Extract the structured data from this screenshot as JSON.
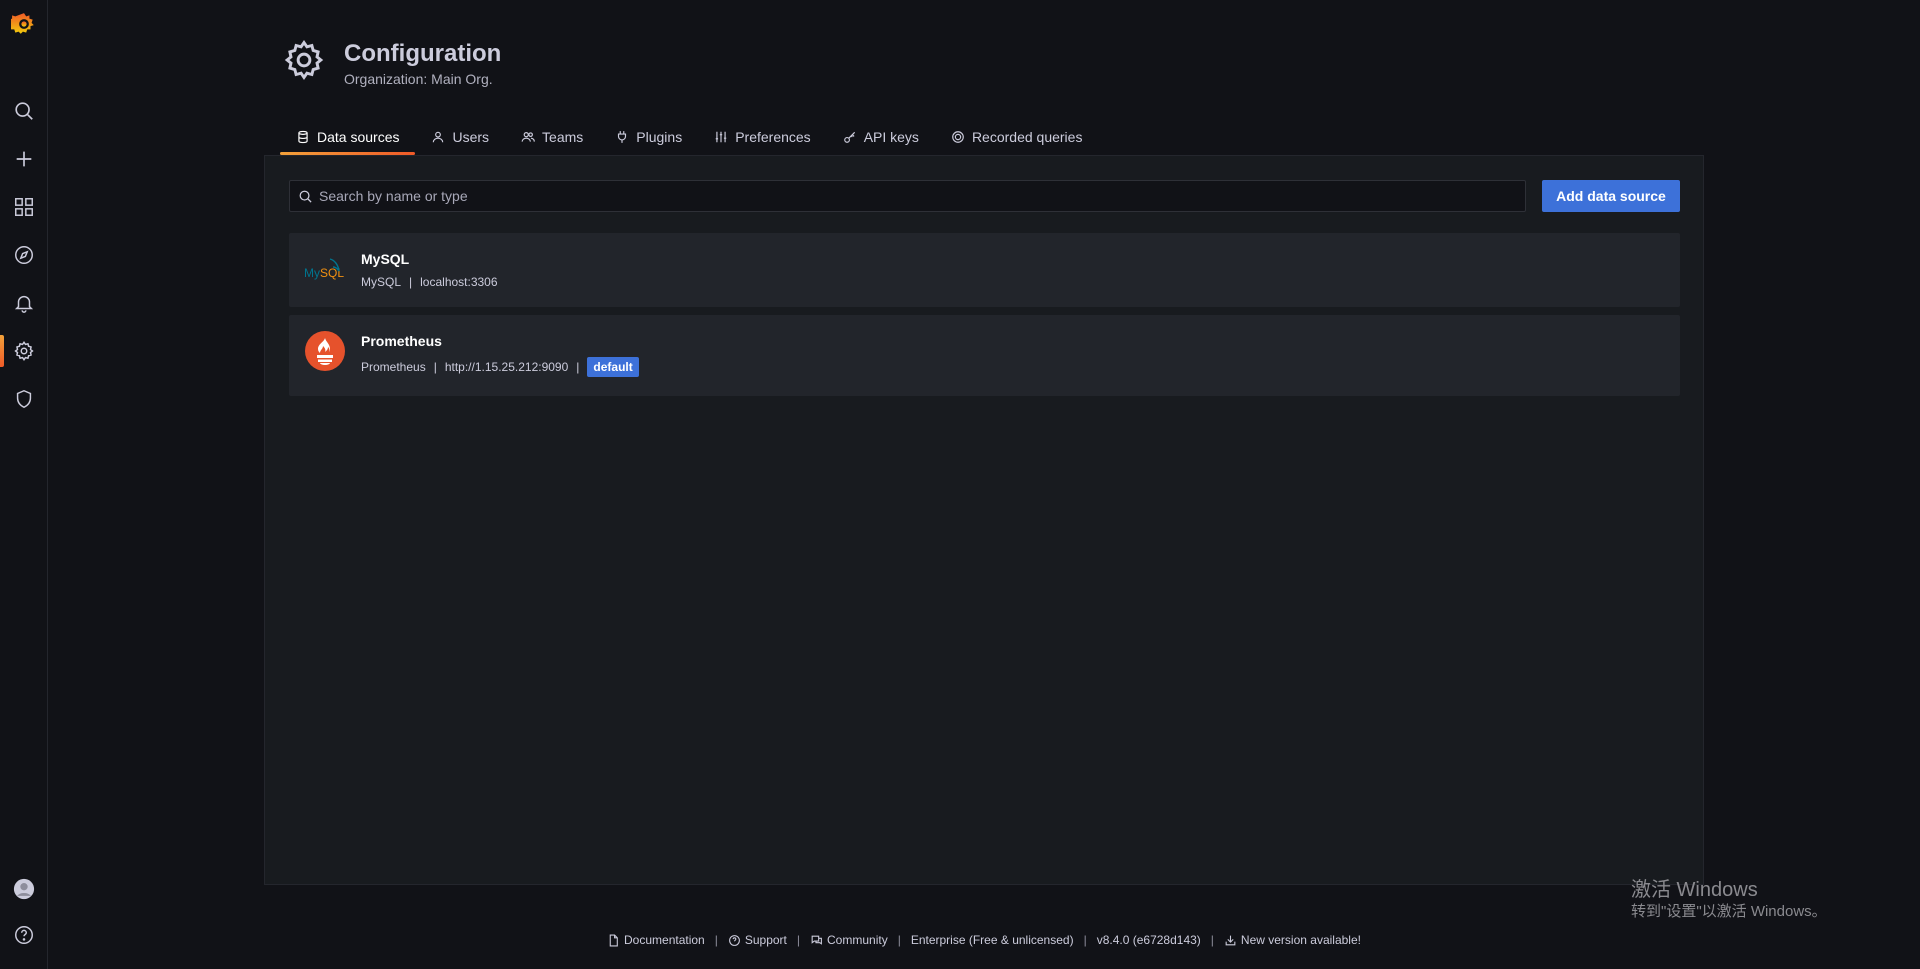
{
  "header": {
    "title": "Configuration",
    "subtitle": "Organization: Main Org."
  },
  "tabs": [
    {
      "label": "Data sources",
      "icon": "database-icon",
      "active": true
    },
    {
      "label": "Users",
      "icon": "user-icon",
      "active": false
    },
    {
      "label": "Teams",
      "icon": "users-icon",
      "active": false
    },
    {
      "label": "Plugins",
      "icon": "plug-icon",
      "active": false
    },
    {
      "label": "Preferences",
      "icon": "sliders-icon",
      "active": false
    },
    {
      "label": "API keys",
      "icon": "key-icon",
      "active": false
    },
    {
      "label": "Recorded queries",
      "icon": "record-icon",
      "active": false
    }
  ],
  "search": {
    "placeholder": "Search by name or type",
    "value": ""
  },
  "add_button_label": "Add data source",
  "datasources": [
    {
      "name": "MySQL",
      "type": "MySQL",
      "url": "localhost:3306",
      "default": false
    },
    {
      "name": "Prometheus",
      "type": "Prometheus",
      "url": "http://1.15.25.212:9090",
      "default": true,
      "default_label": "default"
    }
  ],
  "separator": "|",
  "footer": {
    "documentation": "Documentation",
    "support": "Support",
    "community": "Community",
    "edition": "Enterprise (Free & unlicensed)",
    "version": "v8.4.0 (e6728d143)",
    "new_version": "New version available!"
  },
  "watermark": {
    "line1": "激活 Windows",
    "line2": "转到\"设置\"以激活 Windows。"
  },
  "colors": {
    "accent_gradient_start": "#f2a13a",
    "accent_gradient_end": "#f05a28",
    "primary_button": "#3d71d9",
    "background": "#111217",
    "panel": "#181b1f",
    "card": "#22252b"
  }
}
